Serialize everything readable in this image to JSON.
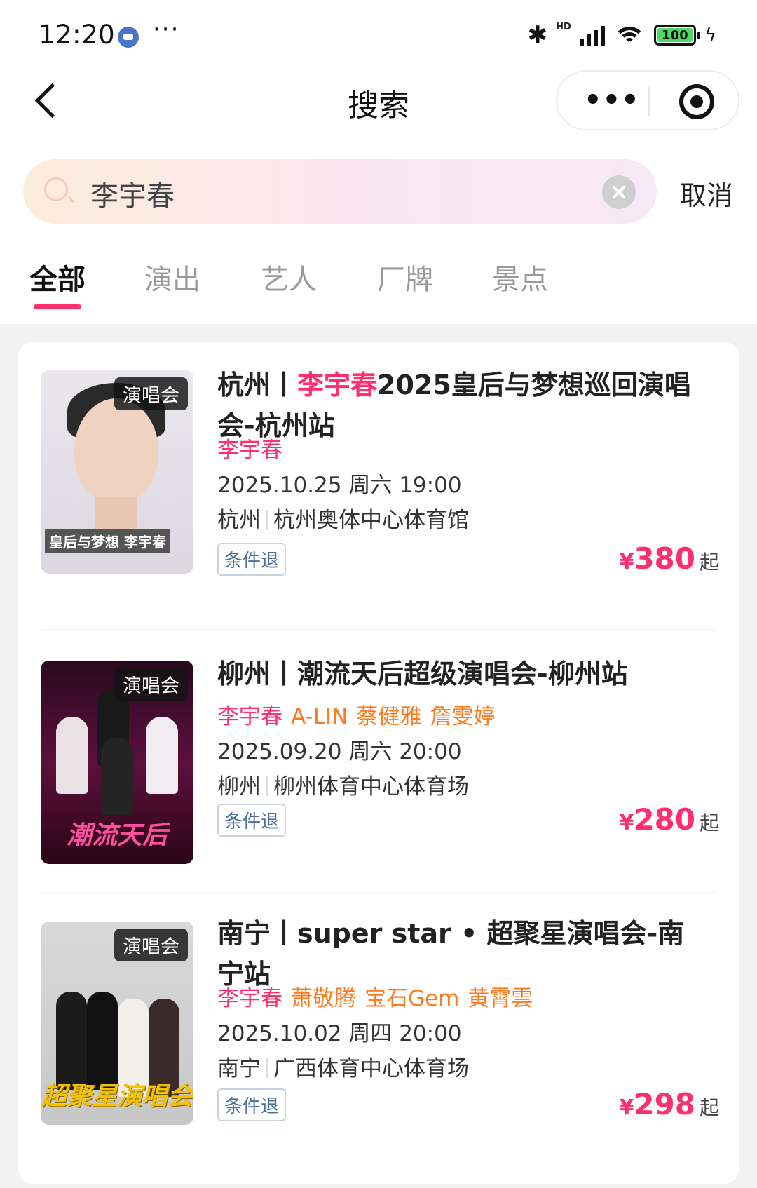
{
  "status_bar": {
    "time": "12:20",
    "battery": "100",
    "network": "HD"
  },
  "nav": {
    "title": "搜索"
  },
  "search": {
    "query": "李宇春",
    "cancel": "取消"
  },
  "tabs": [
    {
      "label": "全部",
      "active": true
    },
    {
      "label": "演出",
      "active": false
    },
    {
      "label": "艺人",
      "active": false
    },
    {
      "label": "厂牌",
      "active": false
    },
    {
      "label": "景点",
      "active": false
    }
  ],
  "results": [
    {
      "tag": "演唱会",
      "title_prefix": "杭州丨",
      "title_highlight": "李宇春",
      "title_suffix": "2025皇后与梦想巡回演唱会-杭州站",
      "artists": [
        "李宇春"
      ],
      "datetime": "2025.10.25 周六 19:00",
      "city": "杭州",
      "venue": "杭州奥体中心体育馆",
      "refund": "条件退",
      "price_symbol": "¥",
      "price": "380",
      "price_suffix": "起",
      "poster_caption": "皇后与梦想 李宇春"
    },
    {
      "tag": "演唱会",
      "title_prefix": "柳州丨潮流天后超级演唱会-柳州站",
      "title_highlight": "",
      "title_suffix": "",
      "artists": [
        "李宇春",
        "A-LIN",
        "蔡健雅",
        "詹雯婷"
      ],
      "datetime": "2025.09.20 周六 20:00",
      "city": "柳州",
      "venue": "柳州体育中心体育场",
      "refund": "条件退",
      "price_symbol": "¥",
      "price": "280",
      "price_suffix": "起",
      "poster_caption": "潮流天后"
    },
    {
      "tag": "演唱会",
      "title_prefix": "南宁丨super star • 超聚星演唱会-南宁站",
      "title_highlight": "",
      "title_suffix": "",
      "artists": [
        "李宇春",
        "萧敬腾",
        "宝石Gem",
        "黄霄雲"
      ],
      "datetime": "2025.10.02 周四 20:00",
      "city": "南宁",
      "venue": "广西体育中心体育场",
      "refund": "条件退",
      "price_symbol": "¥",
      "price": "298",
      "price_suffix": "起",
      "poster_caption": "超聚星演唱会"
    }
  ],
  "colors": {
    "accent": "#ff2e6e",
    "artist_other": "#ff7a1e",
    "badge_text": "#4d6f99"
  }
}
